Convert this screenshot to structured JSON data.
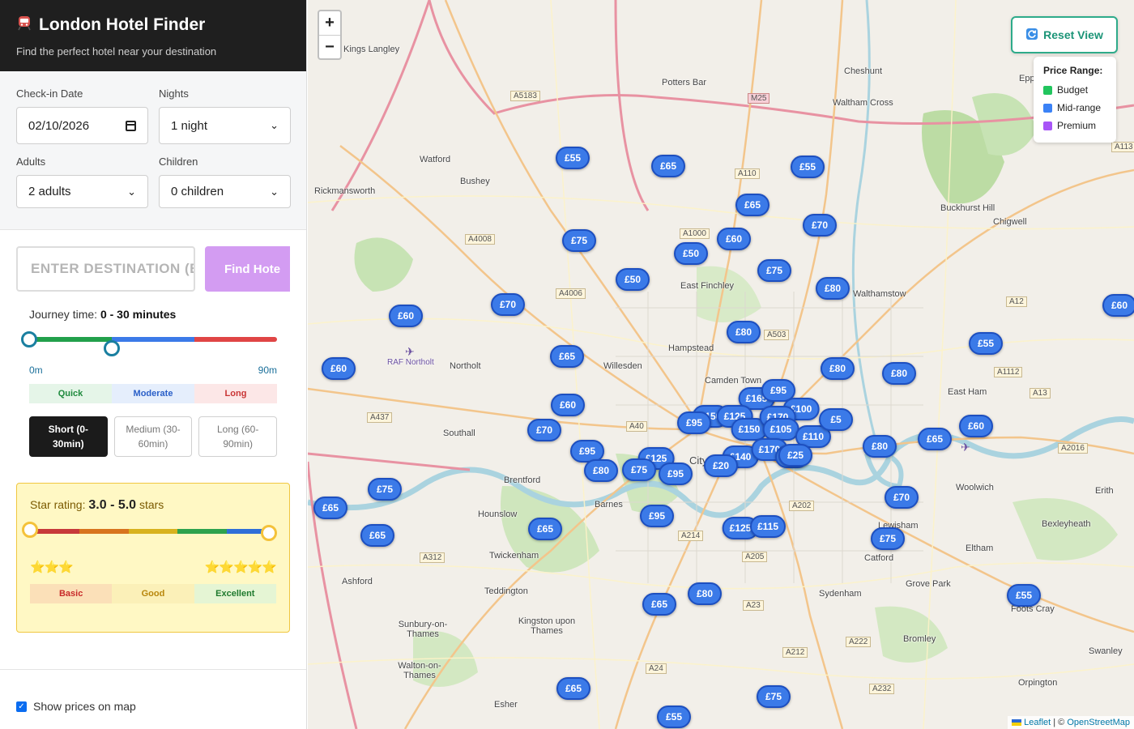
{
  "header": {
    "icon": "train-icon",
    "title": "London Hotel Finder",
    "subtitle": "Find the perfect hotel near your destination"
  },
  "form": {
    "checkin_label": "Check-in Date",
    "checkin_value": "02/10/2026",
    "nights_label": "Nights",
    "nights_value": "1 night",
    "adults_label": "Adults",
    "adults_value": "2 adults",
    "children_label": "Children",
    "children_value": "0 children"
  },
  "search": {
    "placeholder": "ENTER DESTINATION (E.G.",
    "button_label": "Find Hote"
  },
  "journey": {
    "label": "Journey time:",
    "range_text": "0 - 30 minutes",
    "min_label": "0m",
    "max_label": "90m",
    "range_min": 0,
    "range_max": 30,
    "segments": [
      "Quick",
      "Moderate",
      "Long"
    ],
    "buttons": [
      "Short (0-30min)",
      "Medium (30-60min)",
      "Long (60-90min)"
    ],
    "active_button": "Short (0-30min)"
  },
  "stars": {
    "label": "Star rating:",
    "range_text": "3.0 - 5.0",
    "unit": "stars",
    "range_min": 3.0,
    "range_max": 5.0,
    "left_stars": "⭐⭐⭐",
    "right_stars": "⭐⭐⭐⭐⭐",
    "segments": [
      "Basic",
      "Good",
      "Excellent"
    ]
  },
  "show_prices": {
    "label": "Show prices on map",
    "checked": true
  },
  "map": {
    "zoom_in": "+",
    "zoom_out": "−",
    "reset_label": "Reset View",
    "legend": {
      "title": "Price Range:",
      "items": [
        {
          "label": "Budget",
          "color": "#22c55e"
        },
        {
          "label": "Mid-range",
          "color": "#3b82f6"
        },
        {
          "label": "Premium",
          "color": "#a855f7"
        }
      ]
    },
    "attribution_leaflet": "Leaflet",
    "attribution_sep": "| ©",
    "attribution_osm": "OpenStreetMap",
    "places": [
      "Kings Langley",
      "Potters Bar",
      "Cheshunt",
      "Waltham Cross",
      "Watford",
      "Bushey",
      "Rickmansworth",
      "East Finchley",
      "Walthamstow",
      "Chigwell",
      "Buckhurst Hill",
      "Hampstead",
      "Willesden",
      "Camden Town",
      "Northolt",
      "RAF Northolt",
      "Southall",
      "City",
      "Brentford",
      "Hounslow",
      "Barnes",
      "Twickenham",
      "Teddington",
      "Kingston upon Thames",
      "Sunbury-on-Thames",
      "Walton-on-Thames",
      "Esher",
      "Ashford",
      "East Ham",
      "Woolwich",
      "Erith",
      "Bexleyheath",
      "Eltham",
      "Catford",
      "Lewisham",
      "Grove Park",
      "Sydenham",
      "Bromley",
      "Swanley",
      "Foots Cray",
      "Orpington",
      "Epping"
    ],
    "road_refs": [
      "A5183",
      "M25",
      "A110",
      "A1000",
      "A4008",
      "A4006",
      "A503",
      "A40",
      "A437",
      "A312",
      "A12",
      "A1112",
      "A13",
      "A2016",
      "A202",
      "A214",
      "A205",
      "A23",
      "A212",
      "A24",
      "A232",
      "A222",
      "A113"
    ],
    "prices": [
      "£55",
      "£65",
      "£55",
      "£65",
      "£70",
      "£75",
      "£60",
      "£50",
      "£75",
      "£80",
      "£50",
      "£70",
      "£60",
      "£55",
      "£60",
      "£60",
      "£80",
      "£65",
      "£80",
      "£80",
      "£165",
      "£95",
      "£60",
      "£150",
      "£100",
      "£95",
      "£125",
      "£70",
      "£150",
      "£170",
      "£105",
      "£110",
      "£95",
      "£125",
      "£80",
      "£75",
      "£95",
      "£140",
      "£170",
      "£65",
      "£60",
      "£80",
      "£75",
      "£65",
      "£65",
      "£65",
      "£70",
      "£95",
      "£125",
      "£115",
      "£75",
      "£80",
      "£65",
      "£55",
      "£65",
      "£75",
      "£55",
      "£60",
      "£5",
      "£25",
      "£20"
    ]
  }
}
